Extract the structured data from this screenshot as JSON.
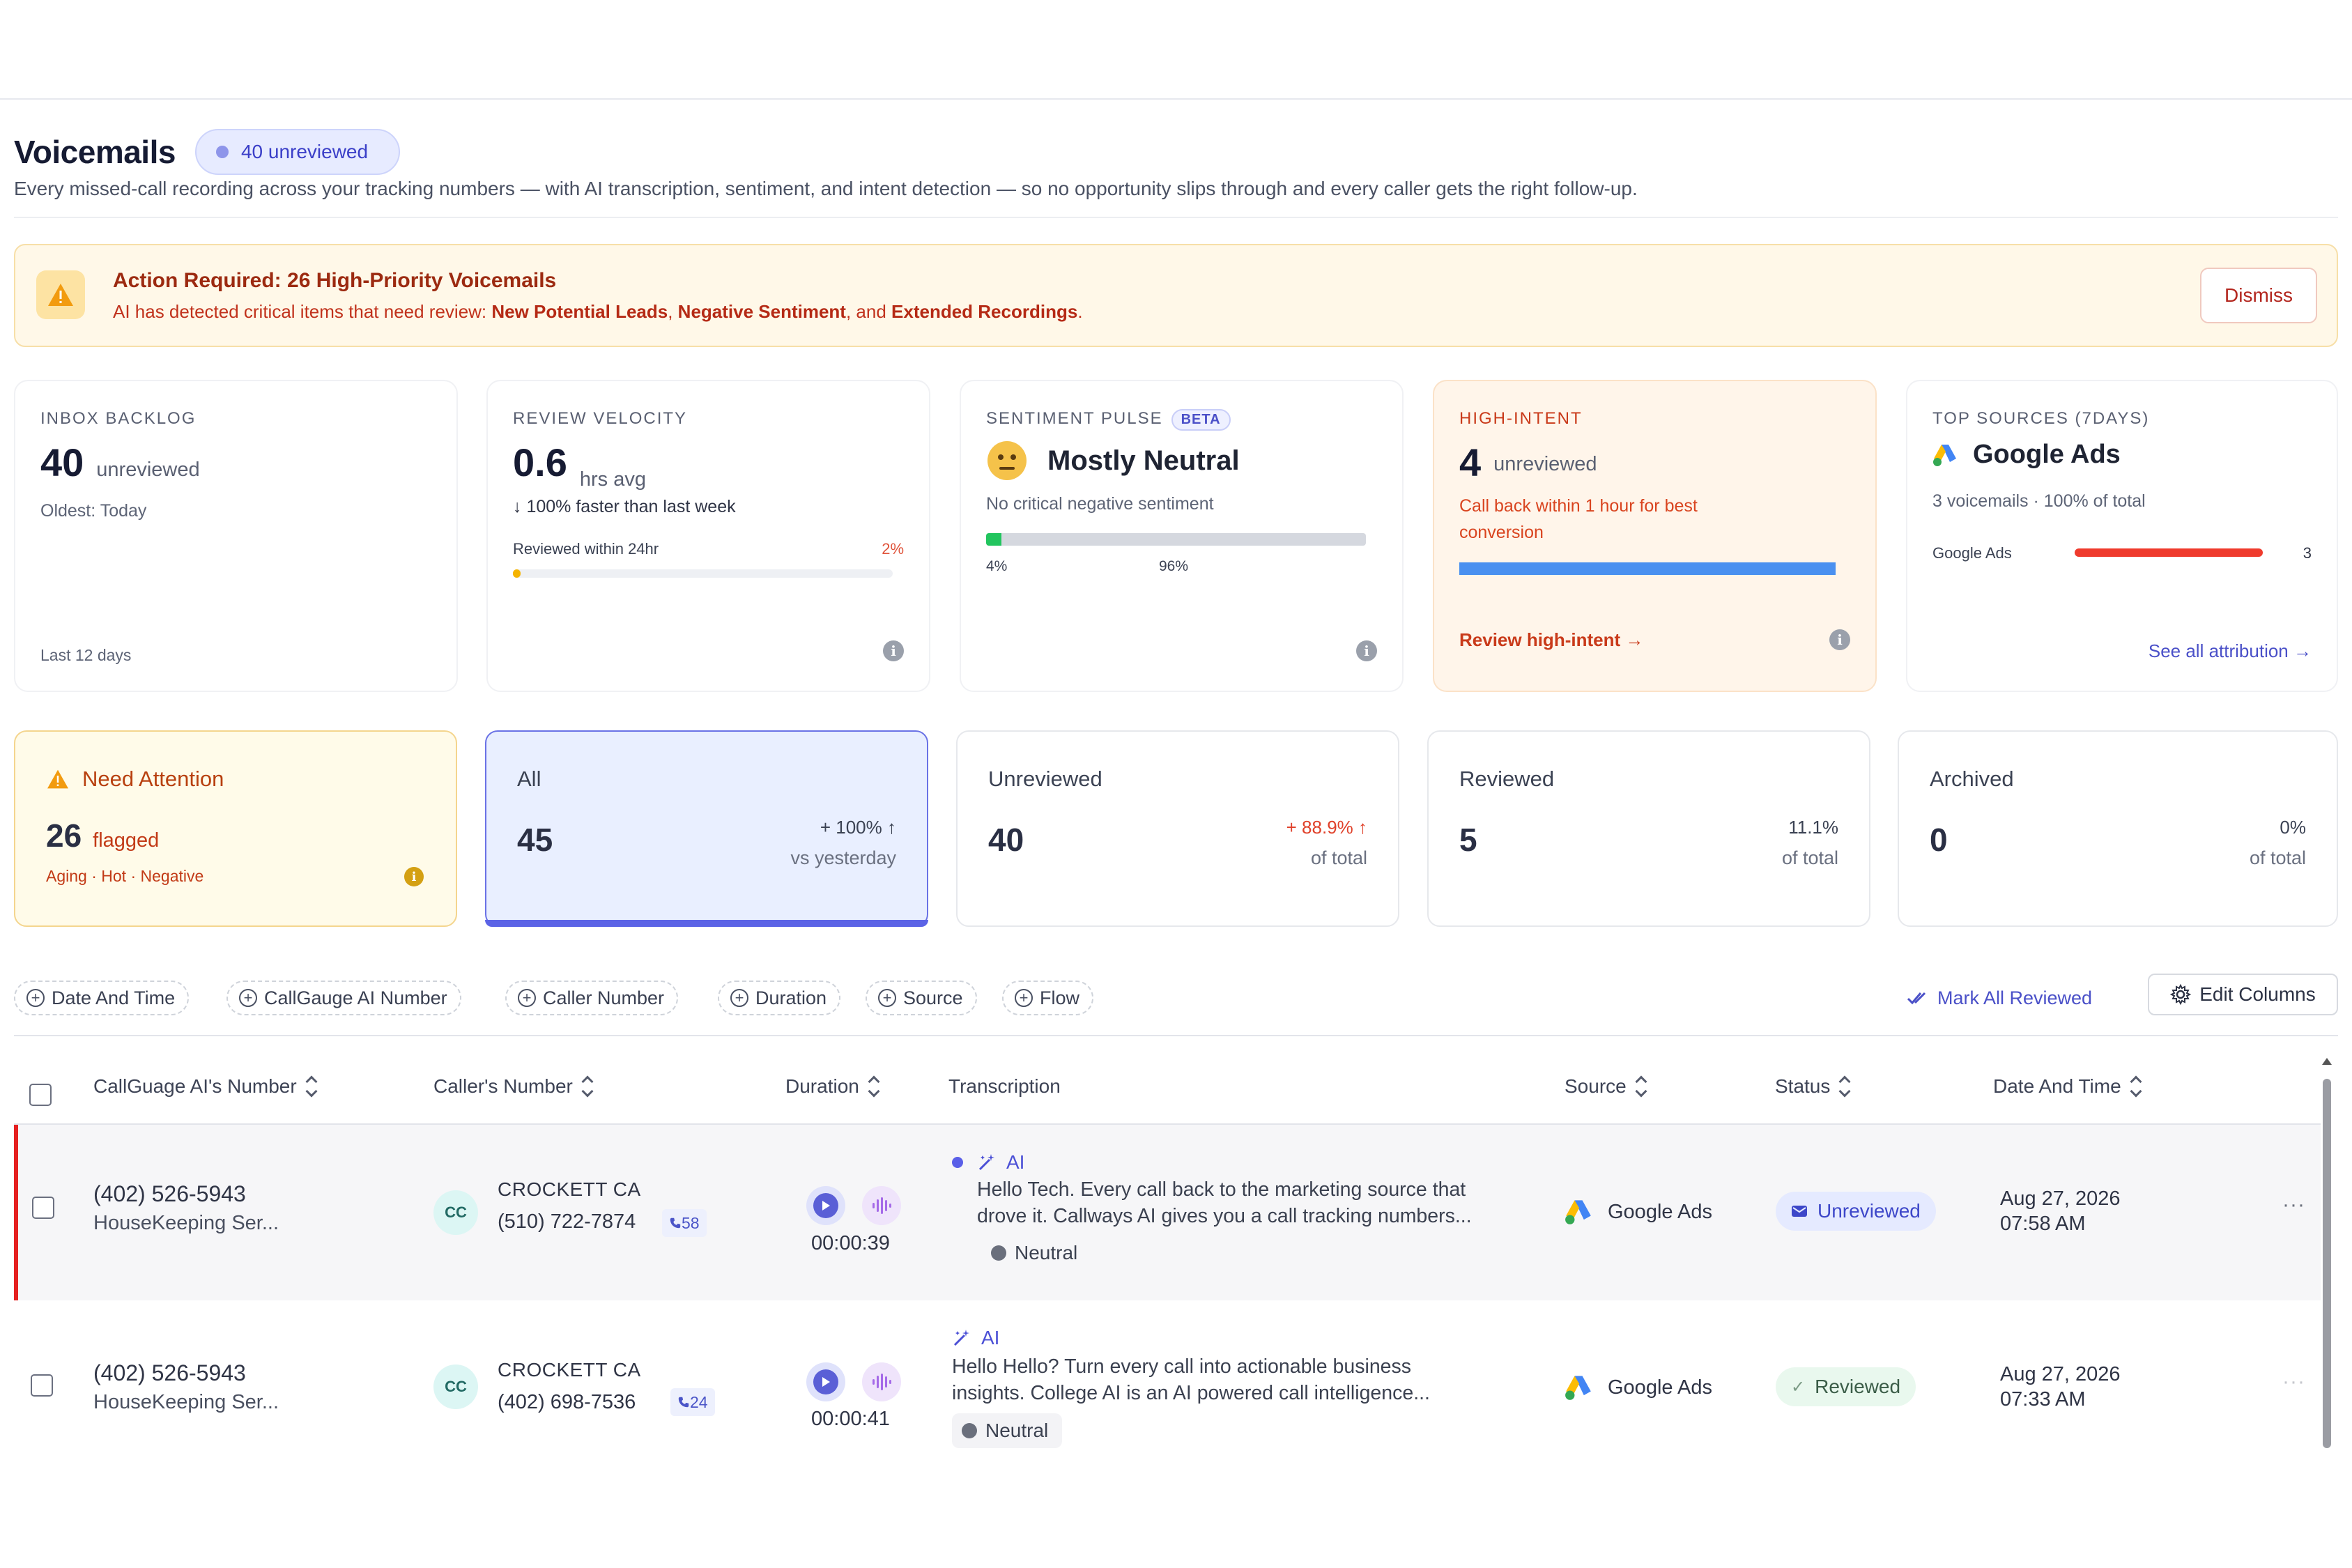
{
  "header": {
    "title": "Voicemails",
    "unreviewed_badge": "40 unreviewed",
    "subtitle": "Every missed-call recording across your tracking numbers — with AI transcription, sentiment, and intent detection — so no opportunity slips through and every caller gets the right follow-up."
  },
  "alert": {
    "title": "Action Required: 26 High-Priority Voicemails",
    "body_prefix": "AI has detected critical items that need review: ",
    "item1": "New Potential Leads",
    "sep1": ", ",
    "item2": "Negative Sentiment",
    "sep2": ", and ",
    "item3": "Extended Recordings",
    "end": ".",
    "dismiss": "Dismiss"
  },
  "metrics": {
    "backlog": {
      "label": "INBOX BACKLOG",
      "value": "40",
      "unit": "unreviewed",
      "oldest": "Oldest: Today",
      "footer": "Last 12 days"
    },
    "velocity": {
      "label": "REVIEW VELOCITY",
      "value": "0.6",
      "unit": "hrs avg",
      "trend": "↓ 100% faster than last week",
      "bar_label": "Reviewed within 24hr",
      "bar_pct_text": "2%",
      "bar_fraction": 0.02
    },
    "sentiment": {
      "label": "SENTIMENT PULSE",
      "beta": "BETA",
      "value": "Mostly Neutral",
      "note": "No critical negative sentiment",
      "positive_pct": "4%",
      "neutral_pct": "96%",
      "positive_fraction": 0.04
    },
    "intent": {
      "label": "HIGH-INTENT",
      "value": "4",
      "unit": "unreviewed",
      "note_line1": "Call back within 1 hour for best",
      "note_line2": "conversion",
      "link": "Review high-intent →",
      "bar_fraction": 1.0
    },
    "sources": {
      "label": "TOP SOURCES (7DAYS)",
      "top": "Google Ads",
      "summary": "3 voicemails · 100% of total",
      "row_name": "Google Ads",
      "row_count": "3",
      "row_fraction": 1.0,
      "link": "See all attribution →"
    }
  },
  "stat_cards": {
    "attention": {
      "label": "Need Attention",
      "value": "26",
      "unit": "flagged",
      "tags": "Aging · Hot · Negative"
    },
    "all": {
      "label": "All",
      "value": "45",
      "pct": "+ 100% ↑",
      "sub": "vs yesterday"
    },
    "unreviewed": {
      "label": "Unreviewed",
      "value": "40",
      "pct": "+ 88.9% ↑",
      "sub": "of total"
    },
    "reviewed": {
      "label": "Reviewed",
      "value": "5",
      "pct": "11.1%",
      "sub": "of total"
    },
    "archived": {
      "label": "Archived",
      "value": "0",
      "pct": "0%",
      "sub": "of total"
    }
  },
  "filters": {
    "chips": [
      "Date And Time",
      "CallGauge AI Number",
      "Caller Number",
      "Duration",
      "Source",
      "Flow"
    ],
    "mark_all": "Mark All Reviewed",
    "edit_columns": "Edit Columns"
  },
  "table": {
    "headers": {
      "number": "CallGuage AI's Number",
      "caller": "Caller's Number",
      "duration": "Duration",
      "transcription": "Transcription",
      "source": "Source",
      "status": "Status",
      "date": "Date And Time"
    },
    "rows": [
      {
        "number": "(402) 526-5943",
        "number_sub": "HouseKeeping Ser...",
        "avatar": "CC",
        "caller_name": "CROCKETT CA",
        "caller_number": "(510) 722-7874",
        "call_count": "58",
        "duration": "00:00:39",
        "ai": "AI",
        "line1": "Hello Tech. Every call back to the marketing source that",
        "line2": "drove it. Callways AI gives you a call tracking numbers...",
        "sentiment": "Neutral",
        "source": "Google Ads",
        "status": "Unreviewed",
        "date": "Aug 27, 2026",
        "time": "07:58 AM",
        "more": "···"
      },
      {
        "number": "(402) 526-5943",
        "number_sub": "HouseKeeping Ser...",
        "avatar": "CC",
        "caller_name": "CROCKETT CA",
        "caller_number": "(402) 698-7536",
        "call_count": "24",
        "duration": "00:00:41",
        "ai": "AI",
        "line1": "Hello Hello? Turn every call into actionable business",
        "line2": "insights. College AI is an AI powered call intelligence...",
        "sentiment": "Neutral",
        "source": "Google Ads",
        "status": "Reviewed",
        "date": "Aug 27, 2026",
        "time": "07:33 AM",
        "more": "···"
      }
    ]
  },
  "colors": {
    "accent": "#5b63e6",
    "danger": "#e52020",
    "warning": "#f29b0f",
    "intent_bar": "#4a90f0",
    "source_bar": "#ef3b2d"
  }
}
